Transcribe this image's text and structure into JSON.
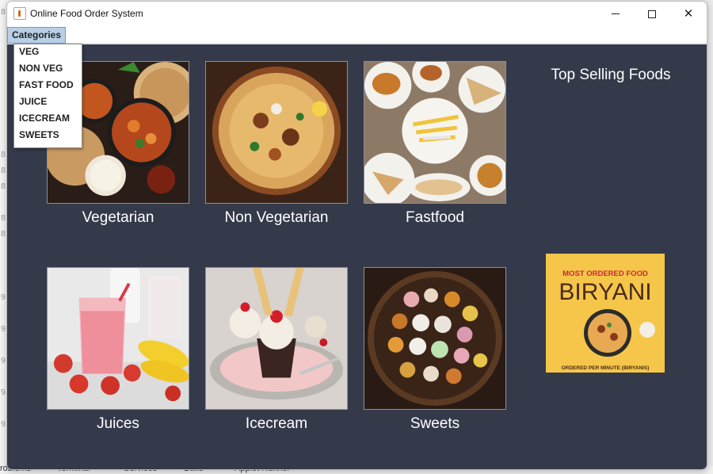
{
  "window": {
    "title": "Online Food Order System"
  },
  "menubar": {
    "categories_label": "Categories"
  },
  "dropdown": {
    "items": [
      "VEG",
      "NON VEG",
      "FAST FOOD",
      "JUICE",
      "ICECREAM",
      "SWEETS"
    ]
  },
  "foods": [
    {
      "label": "Vegetarian"
    },
    {
      "label": "Non Vegetarian"
    },
    {
      "label": "Fastfood"
    },
    {
      "label": "Juices"
    },
    {
      "label": "Icecream"
    },
    {
      "label": "Sweets"
    }
  ],
  "top_selling": {
    "title": "Top Selling Foods",
    "banner_heading": "MOST ORDERED FOOD",
    "banner_name": "BIRYANI",
    "banner_footer": "ORDERED PER MINUTE (BIRYANIS)"
  },
  "ide_bottom": [
    "roblems",
    "Terminal",
    "Services",
    "Build",
    "Applet Runner"
  ],
  "colors": {
    "content_bg": "#343a4a",
    "menu_highlight": "#b8cfe5",
    "promo_bg": "#f5c64a"
  }
}
